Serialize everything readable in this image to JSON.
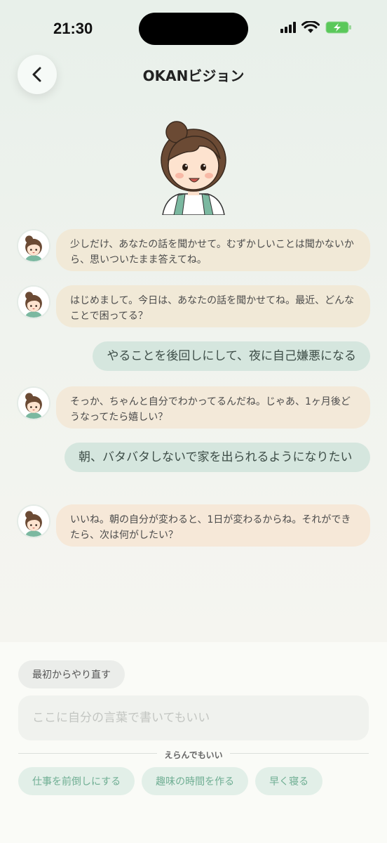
{
  "status": {
    "time": "21:30"
  },
  "header": {
    "title": "OKANビジョン"
  },
  "colors": {
    "okan_bubble_a": "#f1e9d7",
    "okan_bubble_b": "#f6e8d8",
    "user_bubble": "#d5e6de",
    "chip_text": "#6fae93"
  },
  "messages": [
    {
      "from": "okan",
      "text": "少しだけ、あなたの話を聞かせて。むずかしいことは聞かないから、思いついたまま答えてね。"
    },
    {
      "from": "okan",
      "text": "はじめまして。今日は、あなたの話を聞かせてね。最近、どんなことで困ってる？"
    },
    {
      "from": "user",
      "text": "やることを後回しにして、夜に自己嫌悪になる"
    },
    {
      "from": "okan",
      "text": "そっか、ちゃんと自分でわかってるんだね。じゃあ、1ヶ月後どうなってたら嬉しい？"
    },
    {
      "from": "user",
      "text": "朝、バタバタしないで家を出られるようになりたい"
    },
    {
      "from": "okan",
      "text": "いいね。朝の自分が変わると、1日が変わるからね。それができたら、次は何がしたい？"
    }
  ],
  "bottom": {
    "restart_label": "最初からやり直す",
    "input_placeholder": "ここに自分の言葉で書いてもいい",
    "divider_label": "えらんでもいい",
    "chips": [
      "仕事を前倒しにする",
      "趣味の時間を作る",
      "早く寝る"
    ]
  }
}
